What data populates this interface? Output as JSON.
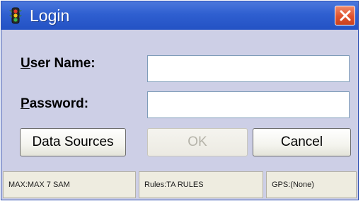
{
  "window": {
    "title": "Login",
    "title_icon": "traffic-light-icon",
    "close_icon": "close-icon"
  },
  "form": {
    "username": {
      "label_mnemonic": "U",
      "label_rest": "ser Name:",
      "value": ""
    },
    "password": {
      "label_mnemonic": "P",
      "label_rest": "assword:",
      "value": ""
    }
  },
  "buttons": {
    "data_sources": "Data Sources",
    "ok": "OK",
    "cancel": "Cancel"
  },
  "statusbar": {
    "max": "MAX:MAX 7 SAM",
    "rules": "Rules:TA RULES",
    "gps": "GPS:(None)"
  },
  "colors": {
    "titlebar": "#2f5fd0",
    "body": "#cdcfe6",
    "close": "#e0522e"
  }
}
